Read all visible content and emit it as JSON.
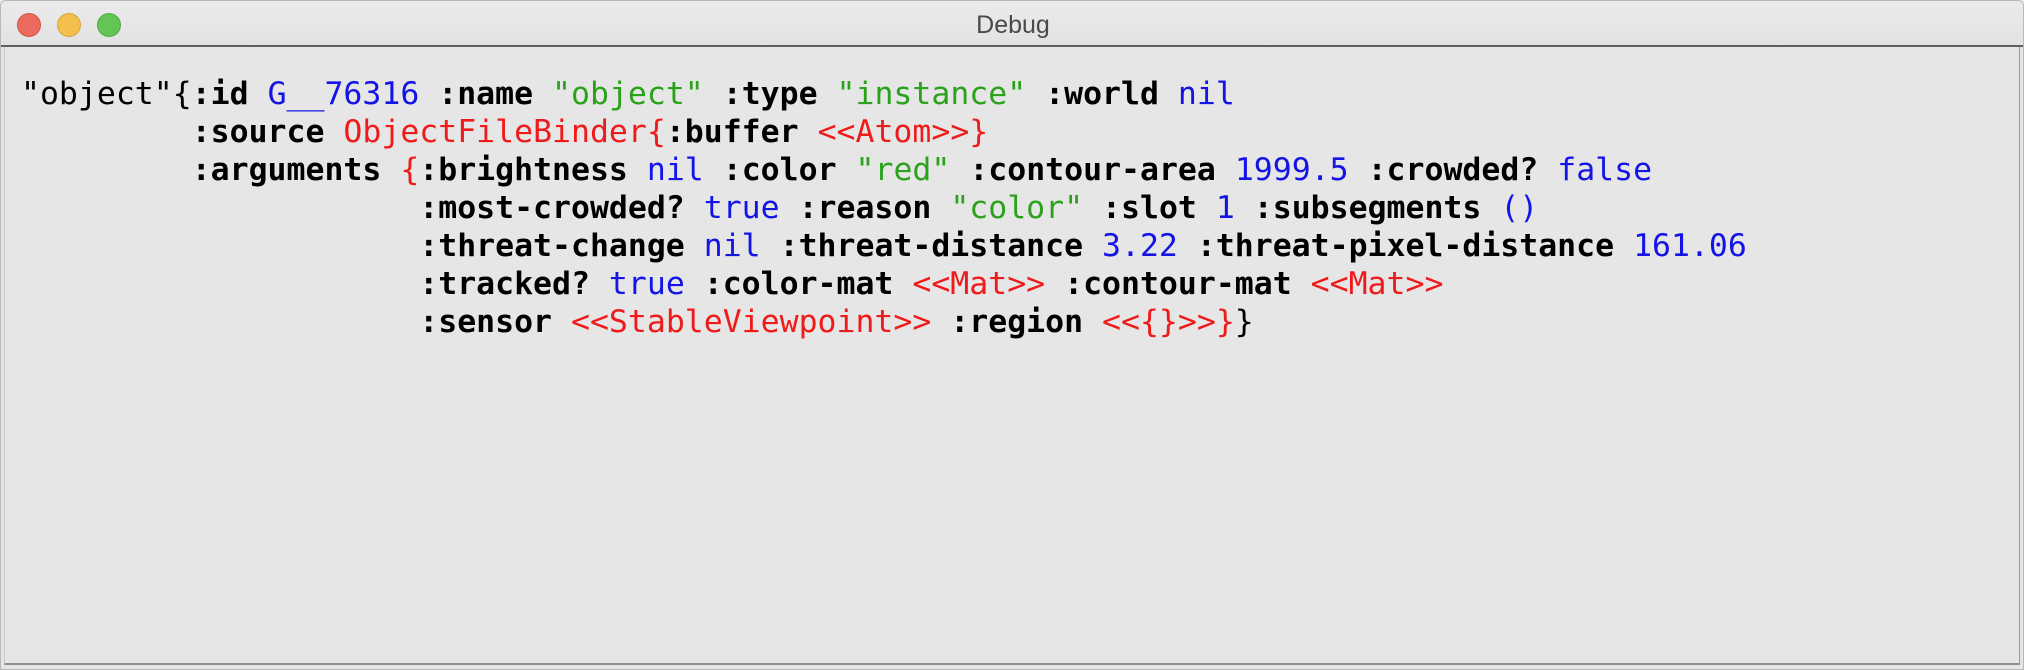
{
  "window": {
    "title": "Debug"
  },
  "colors": {
    "keyword": "#000000",
    "string": "#2aa21a",
    "value": "#1414e6",
    "object": "#ef1b1b"
  },
  "debug": {
    "lines": [
      [
        {
          "t": "plain",
          "text": "\"object\""
        },
        {
          "t": "plain",
          "text": "{"
        },
        {
          "t": "kw",
          "text": ":id"
        },
        {
          "t": "plain",
          "text": " "
        },
        {
          "t": "val",
          "text": "G__76316"
        },
        {
          "t": "plain",
          "text": " "
        },
        {
          "t": "kw",
          "text": ":name"
        },
        {
          "t": "plain",
          "text": " "
        },
        {
          "t": "str",
          "text": "\"object\""
        },
        {
          "t": "plain",
          "text": " "
        },
        {
          "t": "kw",
          "text": ":type"
        },
        {
          "t": "plain",
          "text": " "
        },
        {
          "t": "str",
          "text": "\"instance\""
        },
        {
          "t": "plain",
          "text": " "
        },
        {
          "t": "kw",
          "text": ":world"
        },
        {
          "t": "plain",
          "text": " "
        },
        {
          "t": "val",
          "text": "nil"
        }
      ],
      [
        {
          "t": "plain",
          "text": "         "
        },
        {
          "t": "kw",
          "text": ":source"
        },
        {
          "t": "plain",
          "text": " "
        },
        {
          "t": "obj",
          "text": "ObjectFileBinder{"
        },
        {
          "t": "kw",
          "text": ":buffer"
        },
        {
          "t": "plain",
          "text": " "
        },
        {
          "t": "obj",
          "text": "<<Atom>>}"
        }
      ],
      [
        {
          "t": "plain",
          "text": "         "
        },
        {
          "t": "kw",
          "text": ":arguments"
        },
        {
          "t": "plain",
          "text": " "
        },
        {
          "t": "obj",
          "text": "{"
        },
        {
          "t": "kw",
          "text": ":brightness"
        },
        {
          "t": "plain",
          "text": " "
        },
        {
          "t": "val",
          "text": "nil"
        },
        {
          "t": "plain",
          "text": " "
        },
        {
          "t": "kw",
          "text": ":color"
        },
        {
          "t": "plain",
          "text": " "
        },
        {
          "t": "str",
          "text": "\"red\""
        },
        {
          "t": "plain",
          "text": " "
        },
        {
          "t": "kw",
          "text": ":contour-area"
        },
        {
          "t": "plain",
          "text": " "
        },
        {
          "t": "val",
          "text": "1999.5"
        },
        {
          "t": "plain",
          "text": " "
        },
        {
          "t": "kw",
          "text": ":crowded?"
        },
        {
          "t": "plain",
          "text": " "
        },
        {
          "t": "val",
          "text": "false"
        }
      ],
      [
        {
          "t": "plain",
          "text": "                     "
        },
        {
          "t": "kw",
          "text": ":most-crowded?"
        },
        {
          "t": "plain",
          "text": " "
        },
        {
          "t": "val",
          "text": "true"
        },
        {
          "t": "plain",
          "text": " "
        },
        {
          "t": "kw",
          "text": ":reason"
        },
        {
          "t": "plain",
          "text": " "
        },
        {
          "t": "str",
          "text": "\"color\""
        },
        {
          "t": "plain",
          "text": " "
        },
        {
          "t": "kw",
          "text": ":slot"
        },
        {
          "t": "plain",
          "text": " "
        },
        {
          "t": "val",
          "text": "1"
        },
        {
          "t": "plain",
          "text": " "
        },
        {
          "t": "kw",
          "text": ":subsegments"
        },
        {
          "t": "plain",
          "text": " "
        },
        {
          "t": "val",
          "text": "()"
        }
      ],
      [
        {
          "t": "plain",
          "text": "                     "
        },
        {
          "t": "kw",
          "text": ":threat-change"
        },
        {
          "t": "plain",
          "text": " "
        },
        {
          "t": "val",
          "text": "nil"
        },
        {
          "t": "plain",
          "text": " "
        },
        {
          "t": "kw",
          "text": ":threat-distance"
        },
        {
          "t": "plain",
          "text": " "
        },
        {
          "t": "val",
          "text": "3.22"
        },
        {
          "t": "plain",
          "text": " "
        },
        {
          "t": "kw",
          "text": ":threat-pixel-distance"
        },
        {
          "t": "plain",
          "text": " "
        },
        {
          "t": "val",
          "text": "161.06"
        }
      ],
      [
        {
          "t": "plain",
          "text": "                     "
        },
        {
          "t": "kw",
          "text": ":tracked?"
        },
        {
          "t": "plain",
          "text": " "
        },
        {
          "t": "val",
          "text": "true"
        },
        {
          "t": "plain",
          "text": " "
        },
        {
          "t": "kw",
          "text": ":color-mat"
        },
        {
          "t": "plain",
          "text": " "
        },
        {
          "t": "obj",
          "text": "<<Mat>>"
        },
        {
          "t": "plain",
          "text": " "
        },
        {
          "t": "kw",
          "text": ":contour-mat"
        },
        {
          "t": "plain",
          "text": " "
        },
        {
          "t": "obj",
          "text": "<<Mat>>"
        }
      ],
      [
        {
          "t": "plain",
          "text": "                     "
        },
        {
          "t": "kw",
          "text": ":sensor"
        },
        {
          "t": "plain",
          "text": " "
        },
        {
          "t": "obj",
          "text": "<<StableViewpoint>>"
        },
        {
          "t": "plain",
          "text": " "
        },
        {
          "t": "kw",
          "text": ":region"
        },
        {
          "t": "plain",
          "text": " "
        },
        {
          "t": "obj",
          "text": "<<{}>>}"
        },
        {
          "t": "plain",
          "text": "}"
        }
      ]
    ]
  }
}
